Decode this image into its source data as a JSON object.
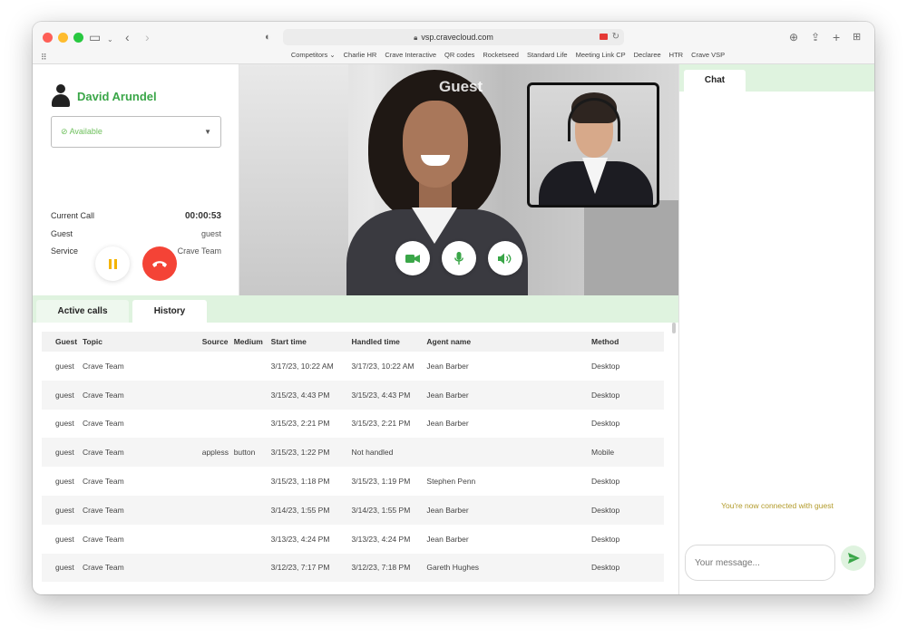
{
  "browser": {
    "url": "vsp.cravecloud.com",
    "bookmarks": [
      "Competitors ⌄",
      "Charlie HR",
      "Crave Interactive",
      "QR codes",
      "Rocketseed",
      "Standard Life",
      "Meeting Link CP",
      "Declaree",
      "HTR",
      "Crave VSP"
    ]
  },
  "agent": {
    "name": "David Arundel",
    "status": "Available",
    "current_call_label": "Current Call",
    "current_call_time": "00:00:53",
    "guest_label": "Guest",
    "guest_value": "guest",
    "service_label": "Service",
    "service_value": "Crave Team"
  },
  "video": {
    "guest_label": "Guest"
  },
  "tabs": {
    "active_calls": "Active calls",
    "history": "History"
  },
  "table": {
    "headers": [
      "Guest",
      "Topic",
      "Source",
      "Medium",
      "Start time",
      "Handled time",
      "Agent name",
      "Method"
    ],
    "rows": [
      [
        "guest",
        "Crave Team",
        "",
        "",
        "3/17/23, 10:22 AM",
        "3/17/23, 10:22 AM",
        "Jean Barber",
        "Desktop"
      ],
      [
        "guest",
        "Crave Team",
        "",
        "",
        "3/15/23, 4:43 PM",
        "3/15/23, 4:43 PM",
        "Jean Barber",
        "Desktop"
      ],
      [
        "guest",
        "Crave Team",
        "",
        "",
        "3/15/23, 2:21 PM",
        "3/15/23, 2:21 PM",
        "Jean Barber",
        "Desktop"
      ],
      [
        "guest",
        "Crave Team",
        "appless",
        "button",
        "3/15/23, 1:22 PM",
        "Not handled",
        "",
        "Mobile"
      ],
      [
        "guest",
        "Crave Team",
        "",
        "",
        "3/15/23, 1:18 PM",
        "3/15/23, 1:19 PM",
        "Stephen Penn",
        "Desktop"
      ],
      [
        "guest",
        "Crave Team",
        "",
        "",
        "3/14/23, 1:55 PM",
        "3/14/23, 1:55 PM",
        "Jean Barber",
        "Desktop"
      ],
      [
        "guest",
        "Crave Team",
        "",
        "",
        "3/13/23, 4:24 PM",
        "3/13/23, 4:24 PM",
        "Jean Barber",
        "Desktop"
      ],
      [
        "guest",
        "Crave Team",
        "",
        "",
        "3/12/23, 7:17 PM",
        "3/12/23, 7:18 PM",
        "Gareth Hughes",
        "Desktop"
      ]
    ]
  },
  "chat": {
    "tab": "Chat",
    "connected_message": "You're now connected with guest",
    "input_placeholder": "Your message..."
  },
  "colors": {
    "accent_green": "#3aa648",
    "hangup_red": "#f44336",
    "pause_yellow": "#f4b400",
    "tab_bar_green": "#dff3df"
  }
}
